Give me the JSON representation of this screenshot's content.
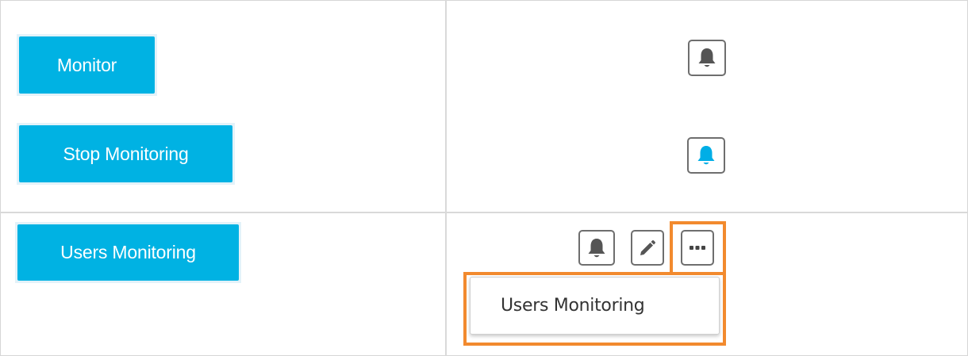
{
  "buttons": {
    "monitor": "Monitor",
    "stop_monitoring": "Stop Monitoring",
    "users_monitoring": "Users Monitoring"
  },
  "icons": {
    "bell_inactive": "bell-icon",
    "bell_active": "bell-icon",
    "edit": "pencil-icon",
    "more": "ellipsis-icon"
  },
  "dropdown": {
    "items": [
      "Users Monitoring"
    ]
  },
  "colors": {
    "button_bg": "#00b2e3",
    "button_text": "#ffffff",
    "bell_active": "#00aee6",
    "icon_gray": "#555555",
    "highlight": "#f28a2e"
  }
}
